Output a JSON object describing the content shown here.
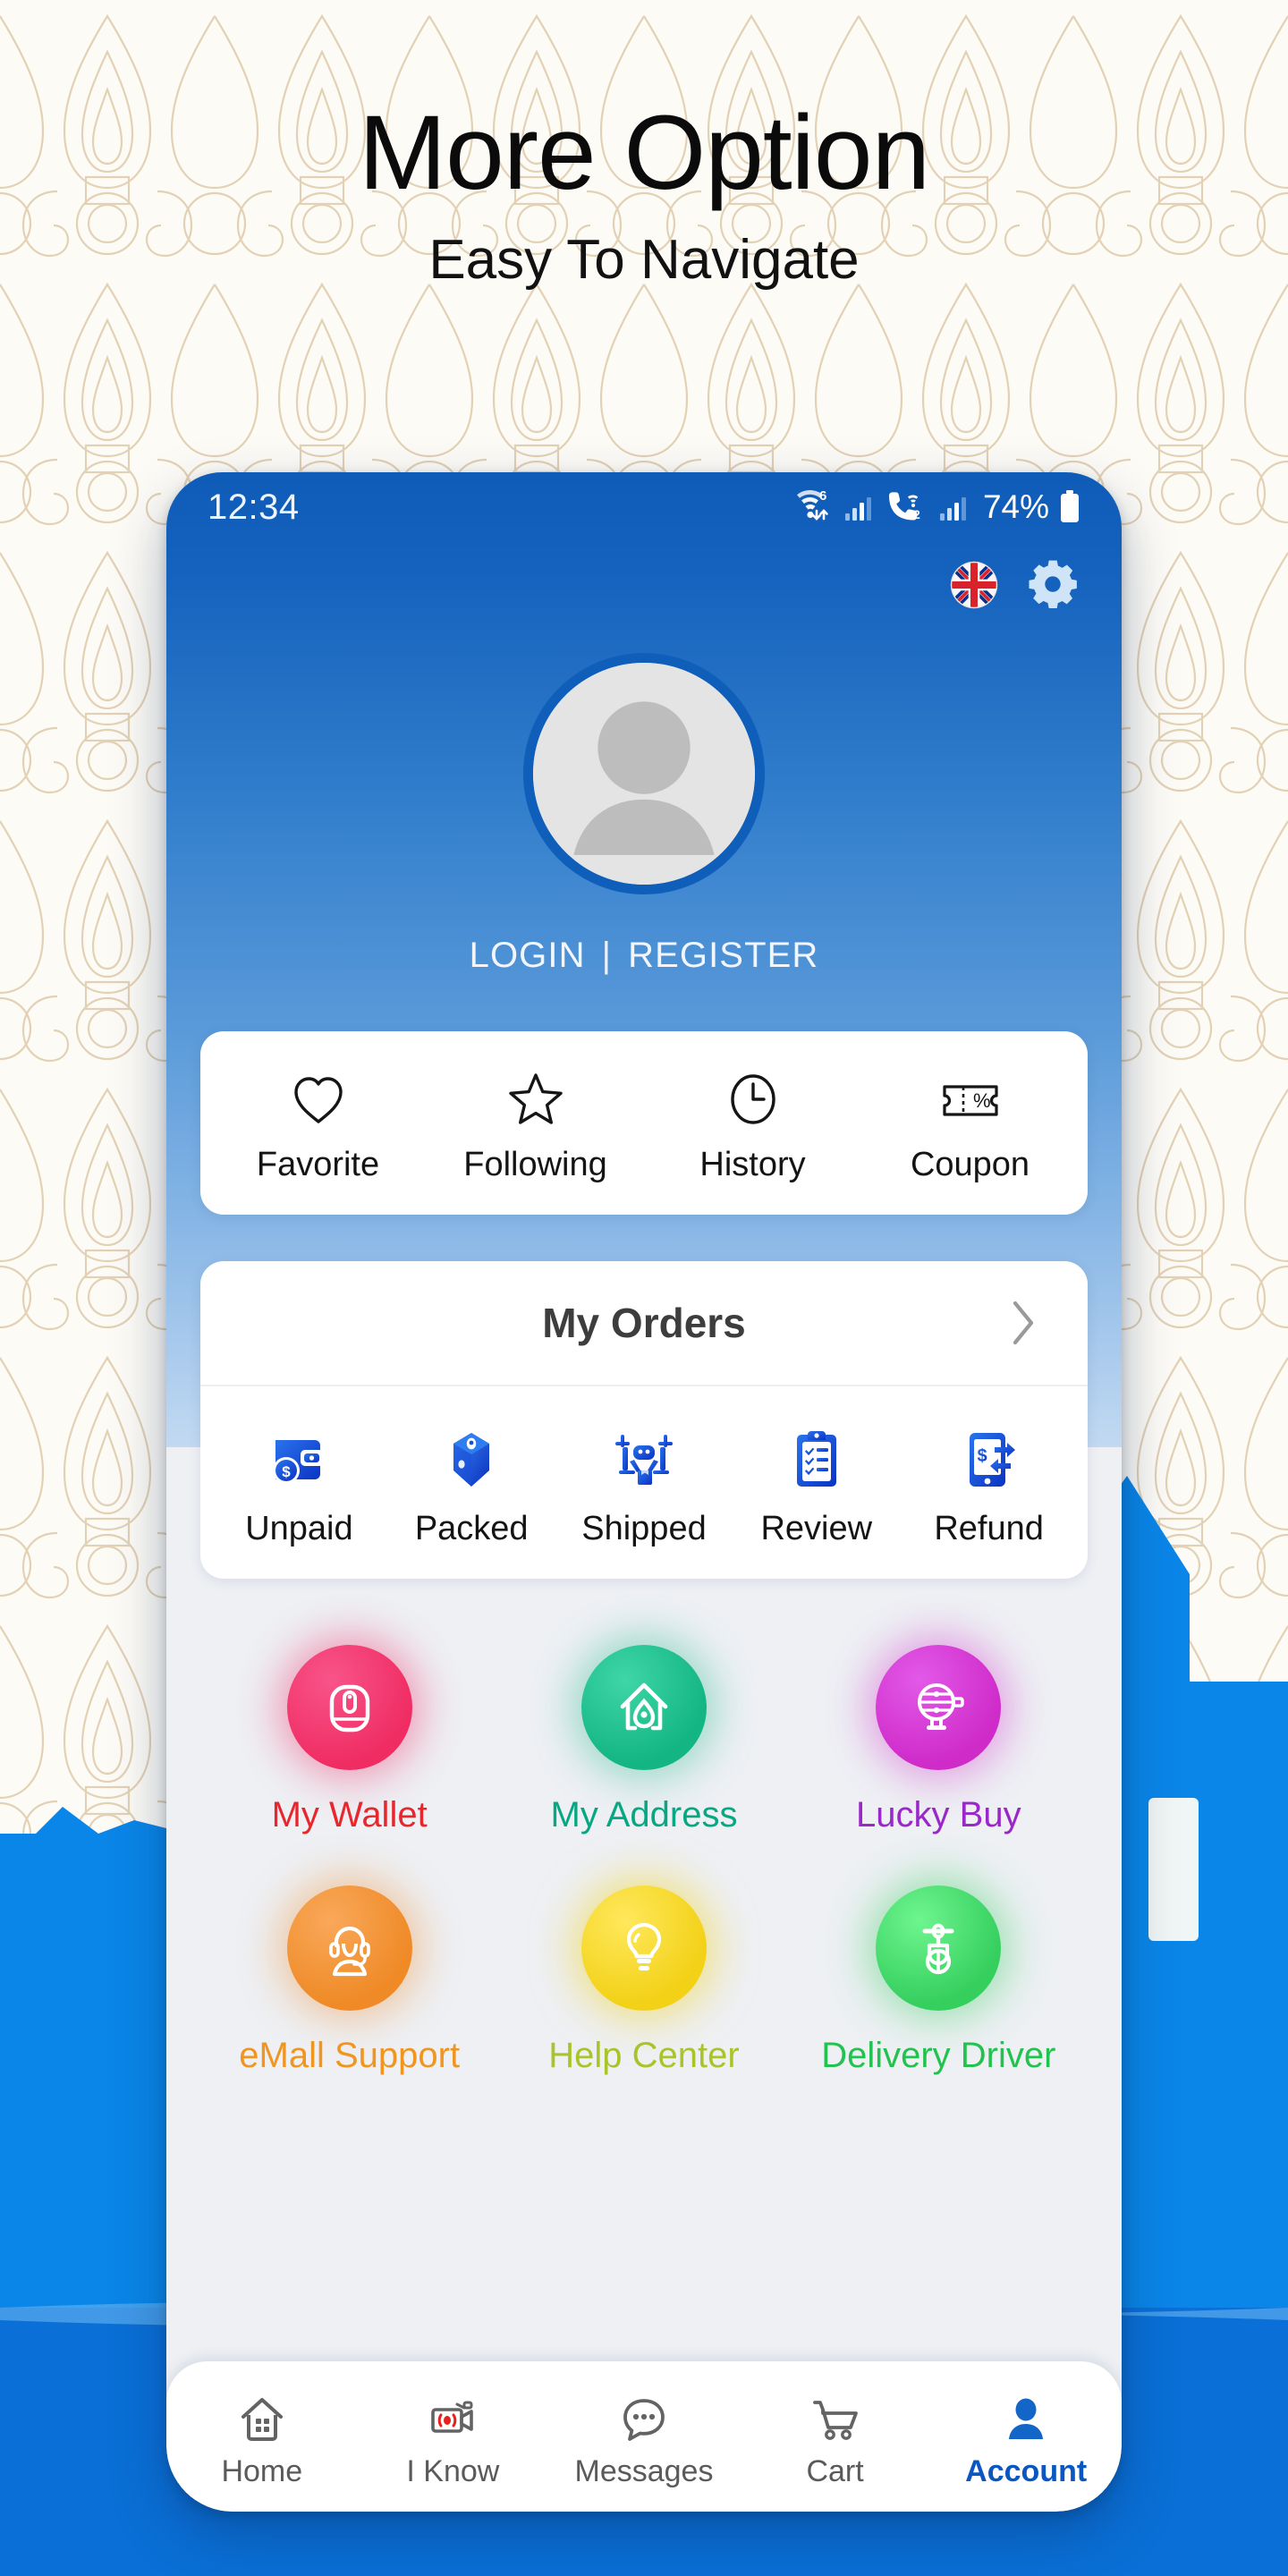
{
  "promo": {
    "title": "More Option",
    "subtitle": "Easy To Navigate"
  },
  "colors": {
    "brand_blue": "#0d5bb5",
    "accent_blue": "#0a57c2",
    "wallet_pink": "#ef2d63",
    "address_green": "#13b583",
    "lucky_magenta": "#cf2bc9",
    "support_orange": "#ef8a26",
    "help_yellow": "#f2d116",
    "driver_green": "#35cf5e",
    "temple_blue": "#0a86e8"
  },
  "statusbar": {
    "time": "12:34",
    "wifi_generation": "6",
    "sim_label": "2",
    "battery": "74%",
    "icons": [
      "wifi-6-icon",
      "signal-bars-icon",
      "wifi-calling-icon",
      "signal-bars-icon",
      "battery-icon"
    ]
  },
  "toolbar": {
    "language_flag": "uk-flag-icon",
    "settings": "gear-icon"
  },
  "account": {
    "avatar": "default-user-avatar",
    "login_label": "LOGIN",
    "separator": "|",
    "register_label": "REGISTER"
  },
  "quick_actions": [
    {
      "label": "Favorite",
      "icon": "heart-icon"
    },
    {
      "label": "Following",
      "icon": "star-icon"
    },
    {
      "label": "History",
      "icon": "clock-icon"
    },
    {
      "label": "Coupon",
      "icon": "coupon-percent-icon"
    }
  ],
  "orders": {
    "title": "My Orders",
    "chevron": "chevron-right-icon",
    "items": [
      {
        "label": "Unpaid",
        "icon": "wallet-dollar-icon"
      },
      {
        "label": "Packed",
        "icon": "package-box-icon"
      },
      {
        "label": "Shipped",
        "icon": "delivery-drone-icon"
      },
      {
        "label": "Review",
        "icon": "clipboard-check-icon"
      },
      {
        "label": "Refund",
        "icon": "phone-refund-icon"
      }
    ]
  },
  "shortcuts": [
    {
      "label": "My Wallet",
      "icon": "wallet-mouse-icon",
      "bubble": "#ef2d63",
      "glow": "#ff5f85",
      "text": "#e8262e"
    },
    {
      "label": "My Address",
      "icon": "home-pin-icon",
      "bubble": "#13b583",
      "glow": "#3ae8b4",
      "text": "#06a883"
    },
    {
      "label": "Lucky Buy",
      "icon": "lucky-wheel-icon",
      "bubble": "#cf2bc9",
      "glow": "#ef5fe8",
      "text": "#9a27c9"
    },
    {
      "label": "eMall Support",
      "icon": "headset-agent-icon",
      "bubble": "#ef8a26",
      "glow": "#ffb15c",
      "text": "#f09520"
    },
    {
      "label": "Help Center",
      "icon": "lightbulb-icon",
      "bubble": "#f2d116",
      "glow": "#ffe95c",
      "text": "#a8c42a"
    },
    {
      "label": "Delivery Driver",
      "icon": "scooter-icon",
      "bubble": "#35cf5e",
      "glow": "#6df58c",
      "text": "#22c24f"
    }
  ],
  "bottom_nav": [
    {
      "label": "Home",
      "icon": "home-icon",
      "active": false
    },
    {
      "label": "I Know",
      "icon": "live-video-icon",
      "active": false
    },
    {
      "label": "Messages",
      "icon": "chat-bubble-icon",
      "active": false
    },
    {
      "label": "Cart",
      "icon": "cart-icon",
      "active": false
    },
    {
      "label": "Account",
      "icon": "user-icon",
      "active": true
    }
  ]
}
